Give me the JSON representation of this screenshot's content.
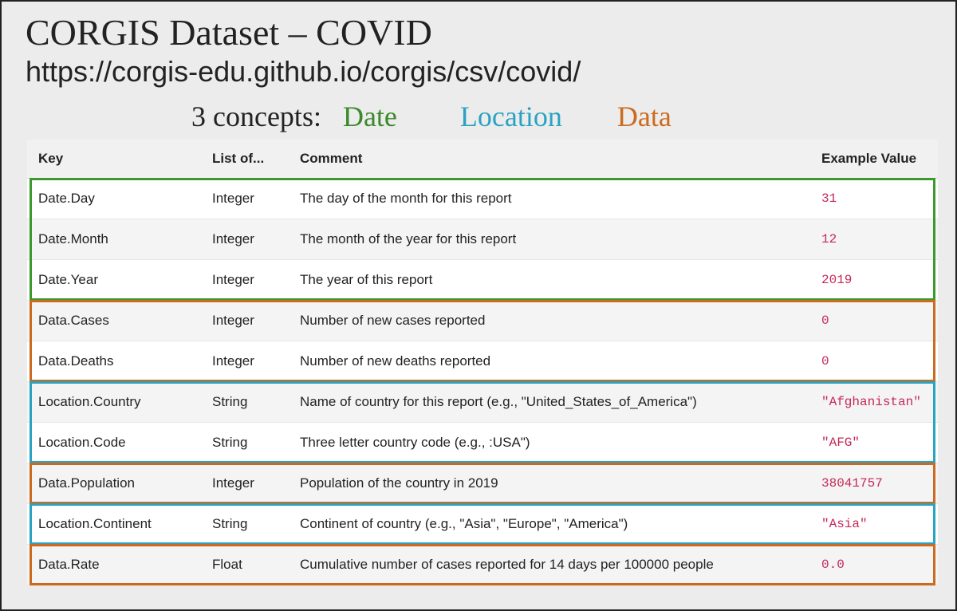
{
  "title": "CORGIS Dataset – COVID",
  "url": "https://corgis-edu.github.io/corgis/csv/covid/",
  "concepts": {
    "label": "3 concepts:",
    "date": "Date",
    "location": "Location",
    "data": "Data"
  },
  "headers": {
    "key": "Key",
    "type": "List of...",
    "comment": "Comment",
    "example": "Example Value"
  },
  "rows": [
    {
      "key": "Date.Day",
      "type": "Integer",
      "comment": "The day of the month for this report",
      "example": "31",
      "alt": false
    },
    {
      "key": "Date.Month",
      "type": "Integer",
      "comment": "The month of the year for this report",
      "example": "12",
      "alt": true
    },
    {
      "key": "Date.Year",
      "type": "Integer",
      "comment": "The year of this report",
      "example": "2019",
      "alt": false
    },
    {
      "key": "Data.Cases",
      "type": "Integer",
      "comment": "Number of new cases reported",
      "example": "0",
      "alt": true
    },
    {
      "key": "Data.Deaths",
      "type": "Integer",
      "comment": "Number of new deaths reported",
      "example": "0",
      "alt": false
    },
    {
      "key": "Location.Country",
      "type": "String",
      "comment": "Name of country for this report (e.g., \"United_States_of_America\")",
      "example": "\"Afghanistan\"",
      "alt": true
    },
    {
      "key": "Location.Code",
      "type": "String",
      "comment": "Three letter country code (e.g., :USA\")",
      "example": "\"AFG\"",
      "alt": false
    },
    {
      "key": "Data.Population",
      "type": "Integer",
      "comment": "Population of the country in 2019",
      "example": "38041757",
      "alt": true
    },
    {
      "key": "Location.Continent",
      "type": "String",
      "comment": "Continent of country (e.g., \"Asia\", \"Europe\", \"America\")",
      "example": "\"Asia\"",
      "alt": false
    },
    {
      "key": "Data.Rate",
      "type": "Float",
      "comment": "Cumulative number of cases reported for 14 days per 100000 people",
      "example": "0.0",
      "alt": true
    }
  ]
}
